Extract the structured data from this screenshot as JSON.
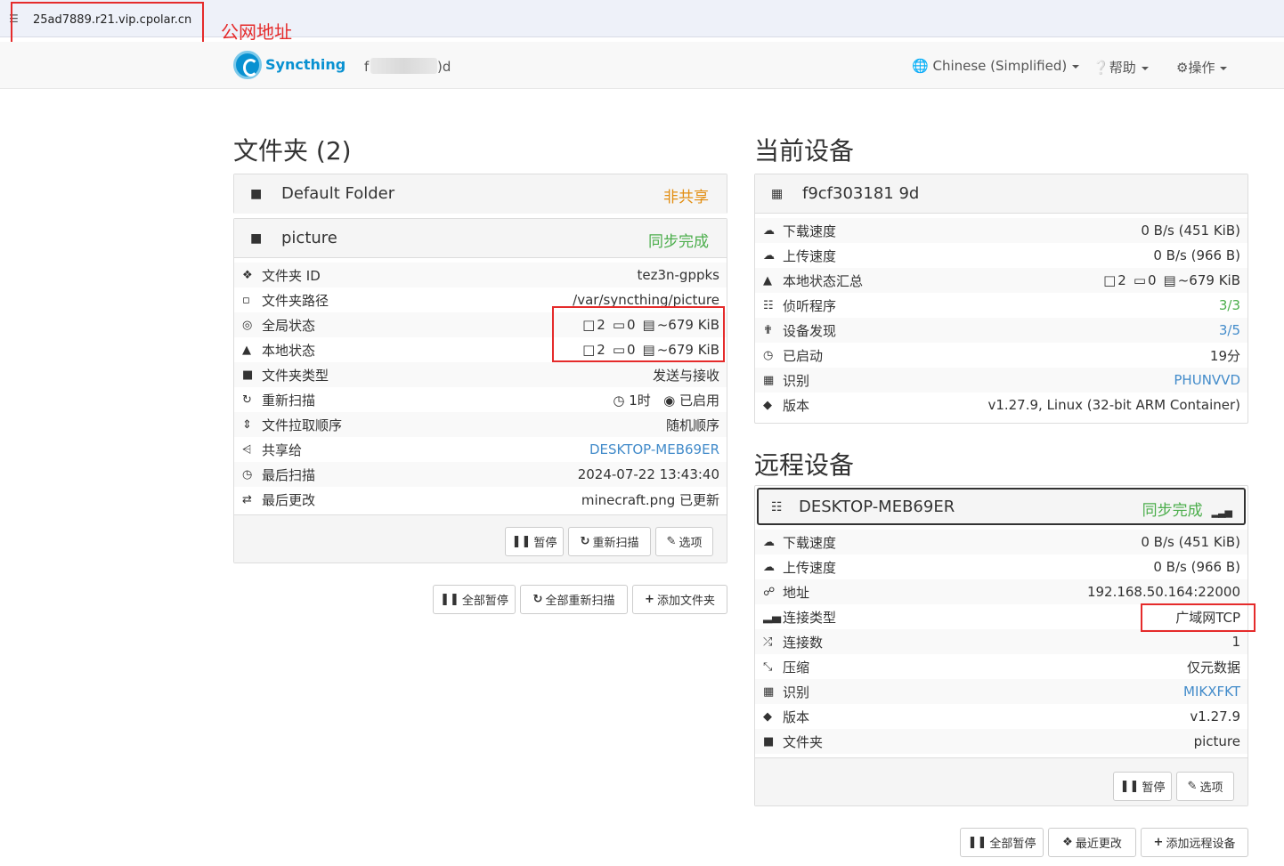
{
  "browser": {
    "url": "25ad7889.r21.vip.cpolar.cn",
    "site_icon": "tune-icon"
  },
  "annotation": {
    "label": "公网地址"
  },
  "navbar": {
    "brand": "Syncthing",
    "device_name_start": "f",
    "device_name_end": ")d",
    "language": "Chinese (Simplified)",
    "help": "帮助",
    "actions": "操作"
  },
  "folders": {
    "title": "文件夹 (2)",
    "default": {
      "name": "Default Folder",
      "status": "非共享"
    },
    "picture": {
      "name": "picture",
      "status": "同步完成",
      "rows": [
        {
          "icon": "info-icon",
          "label": "文件夹 ID",
          "value": "tez3n-gppks"
        },
        {
          "icon": "folder-open-icon",
          "label": "文件夹路径",
          "value": "/var/syncthing/picture"
        },
        {
          "icon": "globe-icon",
          "label": "全局状态",
          "files": "2",
          "dirs": "0",
          "size": "~679 KiB"
        },
        {
          "icon": "home-icon",
          "label": "本地状态",
          "files": "2",
          "dirs": "0",
          "size": "~679 KiB"
        },
        {
          "icon": "folder-icon",
          "label": "文件夹类型",
          "value": "发送与接收"
        },
        {
          "icon": "refresh-icon",
          "label": "重新扫描",
          "interval": "1时",
          "watch": "已启用"
        },
        {
          "icon": "sort-icon",
          "label": "文件拉取顺序",
          "value": "随机顺序"
        },
        {
          "icon": "share-icon",
          "label": "共享给",
          "value": "DESKTOP-MEB69ER"
        },
        {
          "icon": "clock-icon",
          "label": "最后扫描",
          "value": "2024-07-22 13:43:40"
        },
        {
          "icon": "exchange-icon",
          "label": "最后更改",
          "value": "minecraft.png 已更新"
        }
      ],
      "buttons": {
        "pause": "暂停",
        "rescan": "重新扫描",
        "options": "选项"
      }
    },
    "buttons": {
      "pause_all": "全部暂停",
      "rescan_all": "全部重新扫描",
      "add_folder": "添加文件夹"
    }
  },
  "this_device": {
    "title": "当前设备",
    "name": "f9cf303181 9d",
    "rows": [
      {
        "icon": "cloud-download-icon",
        "label": "下载速度",
        "value": "0 B/s (451 KiB)"
      },
      {
        "icon": "cloud-upload-icon",
        "label": "上传速度",
        "value": "0 B/s (966 B)"
      },
      {
        "icon": "home-icon",
        "label": "本地状态汇总",
        "files": "2",
        "dirs": "0",
        "size": "~679 KiB"
      },
      {
        "icon": "sitemap-icon",
        "label": "侦听程序",
        "value": "3/3"
      },
      {
        "icon": "signpost-icon",
        "label": "设备发现",
        "value": "3/5"
      },
      {
        "icon": "clock-icon",
        "label": "已启动",
        "value": "19分"
      },
      {
        "icon": "qrcode-icon",
        "label": "识别",
        "value": "PHUNVVD"
      },
      {
        "icon": "tag-icon",
        "label": "版本",
        "value": "v1.27.9, Linux (32-bit ARM Container)"
      }
    ]
  },
  "remote_devices": {
    "title": "远程设备",
    "device": {
      "name": "DESKTOP-MEB69ER",
      "status": "同步完成",
      "rows": [
        {
          "icon": "cloud-download-icon",
          "label": "下载速度",
          "value": "0 B/s (451 KiB)"
        },
        {
          "icon": "cloud-upload-icon",
          "label": "上传速度",
          "value": "0 B/s (966 B)"
        },
        {
          "icon": "link-icon",
          "label": "地址",
          "value": "192.168.50.164:22000"
        },
        {
          "icon": "signal-icon",
          "label": "连接类型",
          "value": "广域网TCP"
        },
        {
          "icon": "random-icon",
          "label": "连接数",
          "value": "1"
        },
        {
          "icon": "compress-icon",
          "label": "压缩",
          "value": "仅元数据"
        },
        {
          "icon": "qrcode-icon",
          "label": "识别",
          "value": "MIKXFKT"
        },
        {
          "icon": "tag-icon",
          "label": "版本",
          "value": "v1.27.9"
        },
        {
          "icon": "folder-icon",
          "label": "文件夹",
          "value": "picture"
        }
      ],
      "buttons": {
        "pause": "暂停",
        "options": "选项"
      }
    },
    "buttons": {
      "pause_all": "全部暂停",
      "recent_changes": "最近更改",
      "add_device": "添加远程设备"
    }
  },
  "colors": {
    "accent": "#428bca",
    "success": "#4cae4c",
    "warning": "#e28e12",
    "highlight": "#e52b2b",
    "brand": "#0891d1"
  }
}
